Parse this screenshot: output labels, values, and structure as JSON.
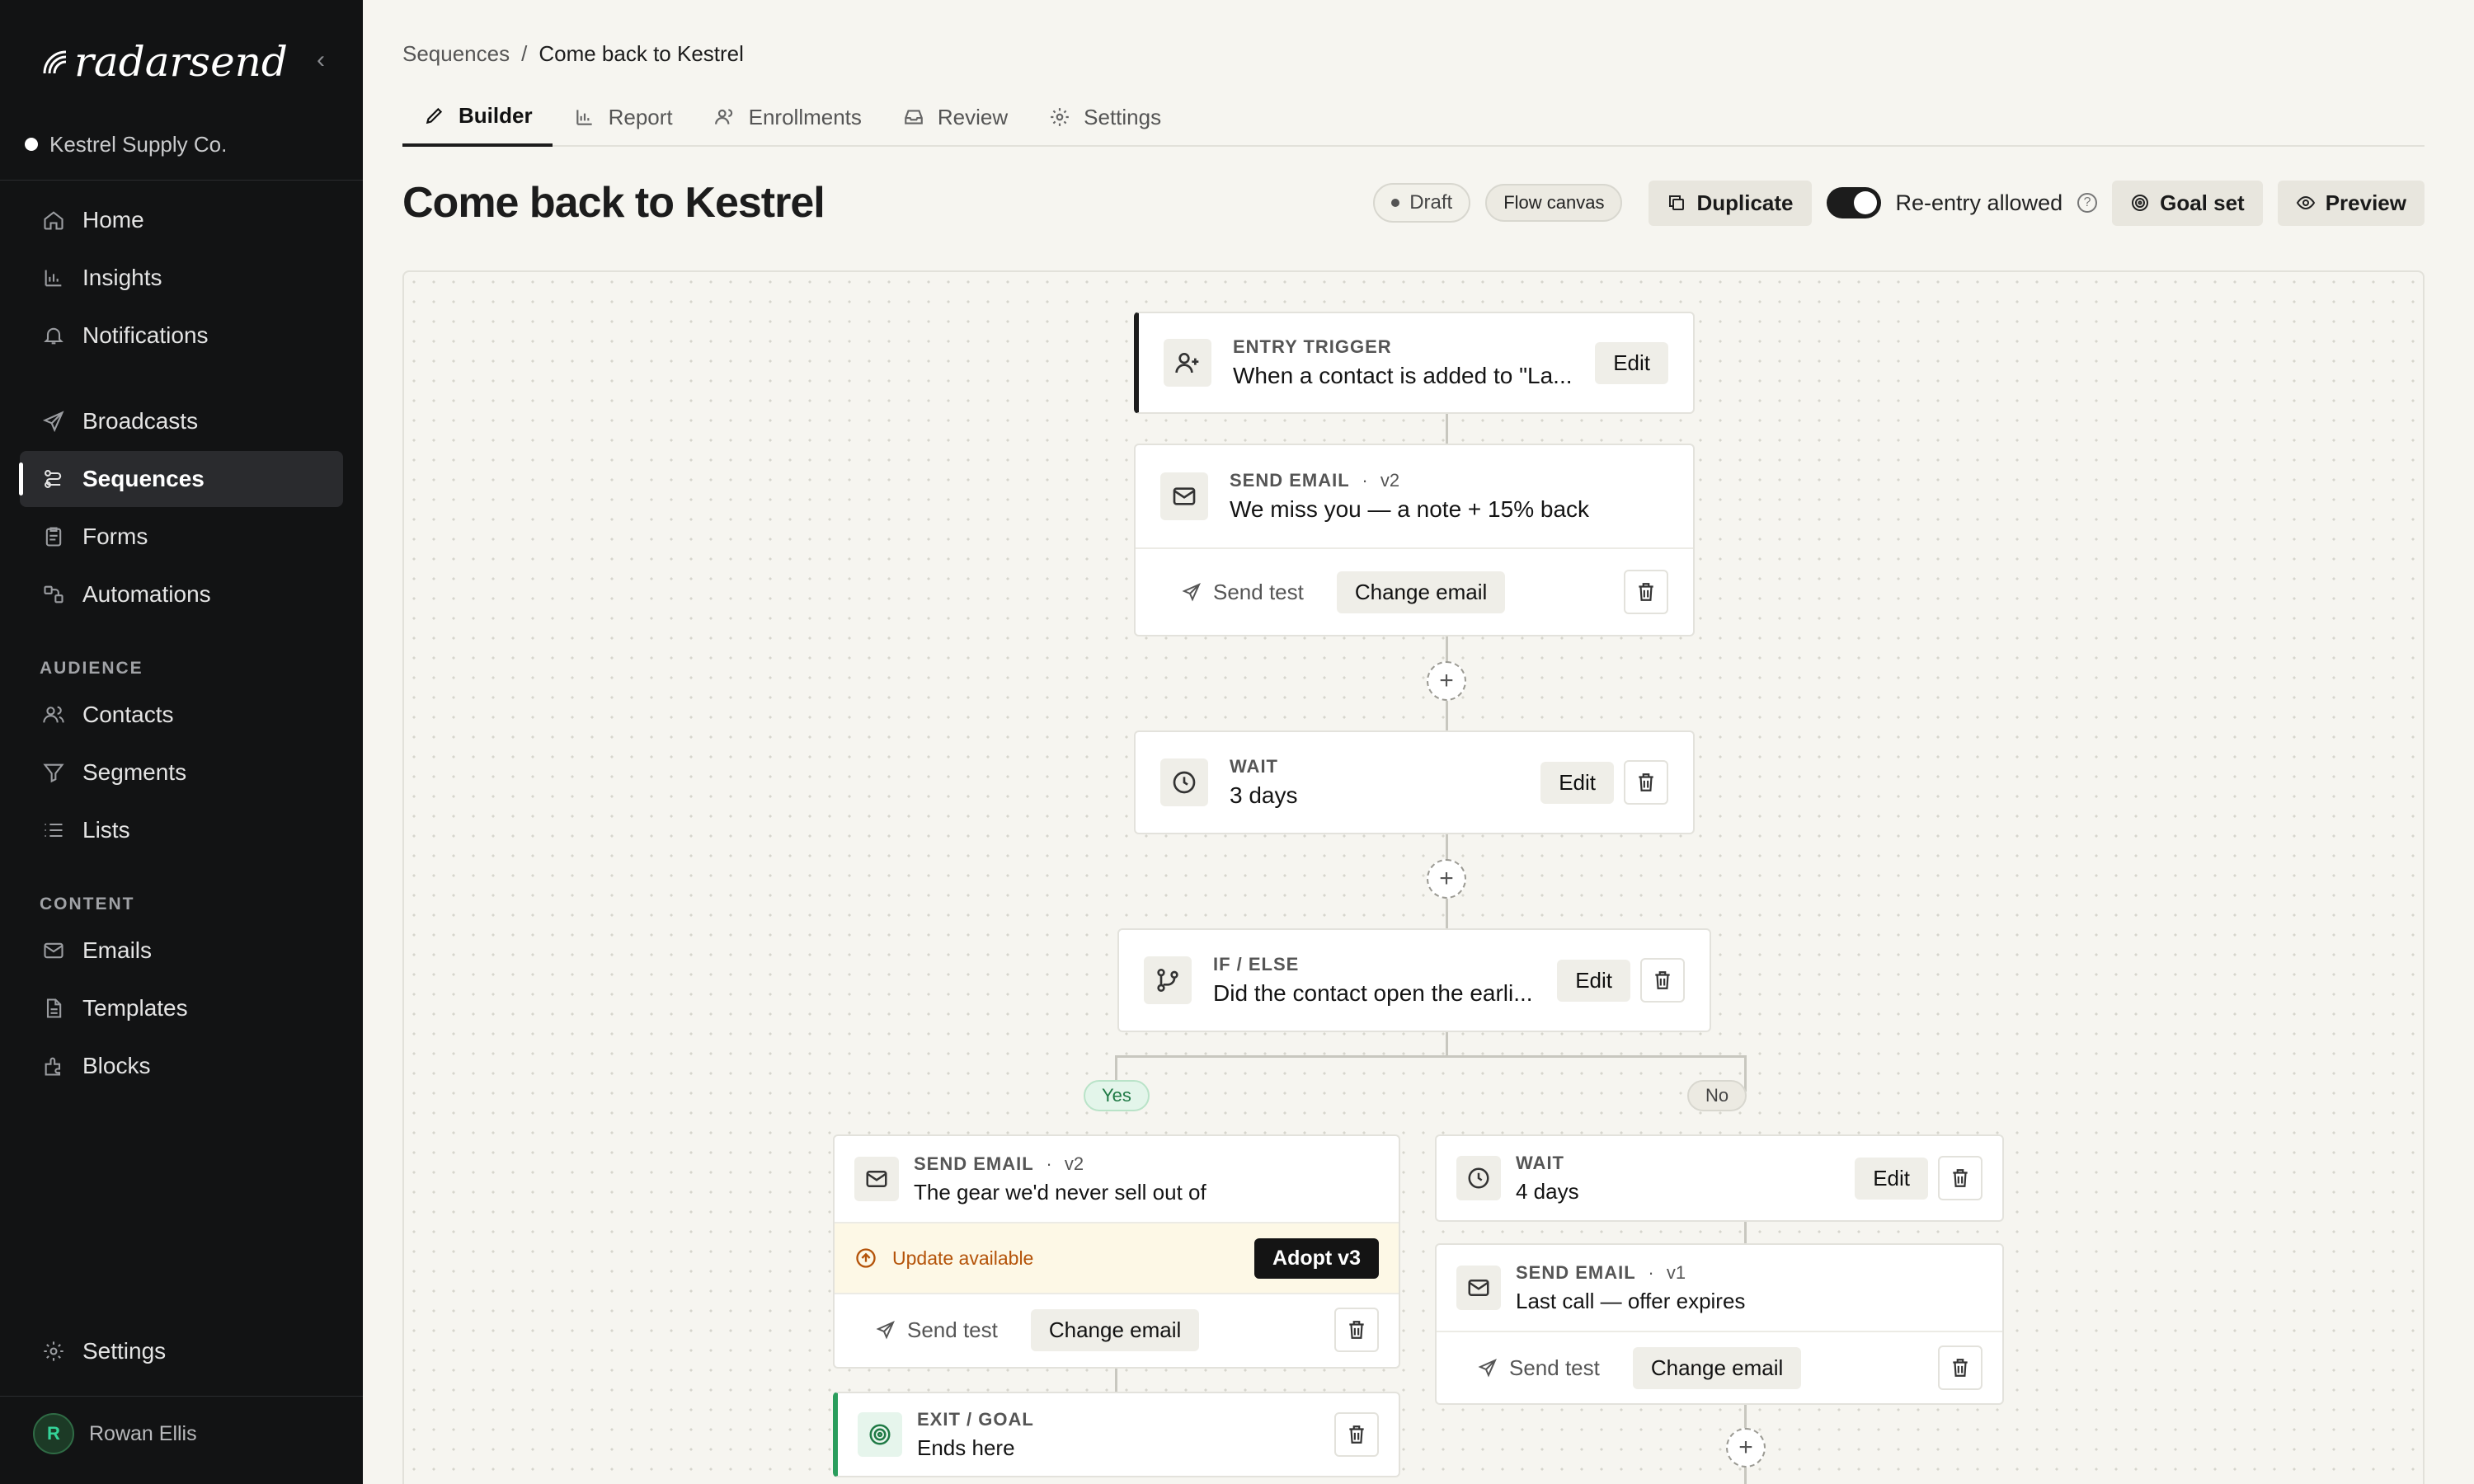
{
  "brand": {
    "name": "radarsend"
  },
  "workspace": {
    "name": "Kestrel Supply Co."
  },
  "nav": {
    "primary": [
      {
        "label": "Home",
        "icon": "home-icon"
      },
      {
        "label": "Insights",
        "icon": "chart-icon"
      },
      {
        "label": "Notifications",
        "icon": "bell-icon"
      }
    ],
    "messaging": [
      {
        "label": "Broadcasts",
        "icon": "send-icon"
      },
      {
        "label": "Sequences",
        "icon": "sequences-icon",
        "active": true
      },
      {
        "label": "Forms",
        "icon": "form-icon"
      },
      {
        "label": "Automations",
        "icon": "automation-icon"
      }
    ],
    "audience_label": "AUDIENCE",
    "audience": [
      {
        "label": "Contacts",
        "icon": "contacts-icon"
      },
      {
        "label": "Segments",
        "icon": "filter-icon"
      },
      {
        "label": "Lists",
        "icon": "list-icon"
      }
    ],
    "content_label": "CONTENT",
    "content": [
      {
        "label": "Emails",
        "icon": "mail-icon"
      },
      {
        "label": "Templates",
        "icon": "template-icon"
      },
      {
        "label": "Blocks",
        "icon": "blocks-icon"
      }
    ],
    "settings": "Settings"
  },
  "user": {
    "initial": "R",
    "name": "Rowan Ellis"
  },
  "breadcrumb": {
    "parent": "Sequences",
    "separator": "/",
    "current": "Come back to Kestrel"
  },
  "tabs": [
    {
      "label": "Builder",
      "active": true
    },
    {
      "label": "Report"
    },
    {
      "label": "Enrollments"
    },
    {
      "label": "Review"
    },
    {
      "label": "Settings"
    }
  ],
  "header": {
    "title": "Come back to Kestrel",
    "status": "Draft",
    "view": "Flow canvas",
    "duplicate": "Duplicate",
    "reentry": "Re-entry allowed",
    "reentry_enabled": true,
    "goal": "Goal set",
    "preview": "Preview"
  },
  "flow": {
    "trigger": {
      "kind": "ENTRY TRIGGER",
      "title": "When a contact is added to \"La...",
      "edit": "Edit"
    },
    "email1": {
      "kind": "SEND EMAIL",
      "version": "v2",
      "title": "We miss you — a note + 15% back",
      "send_test": "Send test",
      "change": "Change email"
    },
    "wait1": {
      "kind": "WAIT",
      "title": "3 days",
      "edit": "Edit"
    },
    "ifelse": {
      "kind": "IF / ELSE",
      "title": "Did the contact open the earli...",
      "edit": "Edit"
    },
    "yes_label": "Yes",
    "no_label": "No",
    "yes_email": {
      "kind": "SEND EMAIL",
      "version": "v2",
      "title": "The gear we'd never sell out of",
      "update": "Update available",
      "adopt": "Adopt v3",
      "send_test": "Send test",
      "change": "Change email"
    },
    "exit": {
      "kind": "EXIT / GOAL",
      "title": "Ends here"
    },
    "no_wait": {
      "kind": "WAIT",
      "title": "4 days",
      "edit": "Edit"
    },
    "no_email": {
      "kind": "SEND EMAIL",
      "version": "v1",
      "title": "Last call — offer expires",
      "send_test": "Send test",
      "change": "Change email"
    },
    "add_symbol": "+",
    "dot_sep": "·"
  }
}
